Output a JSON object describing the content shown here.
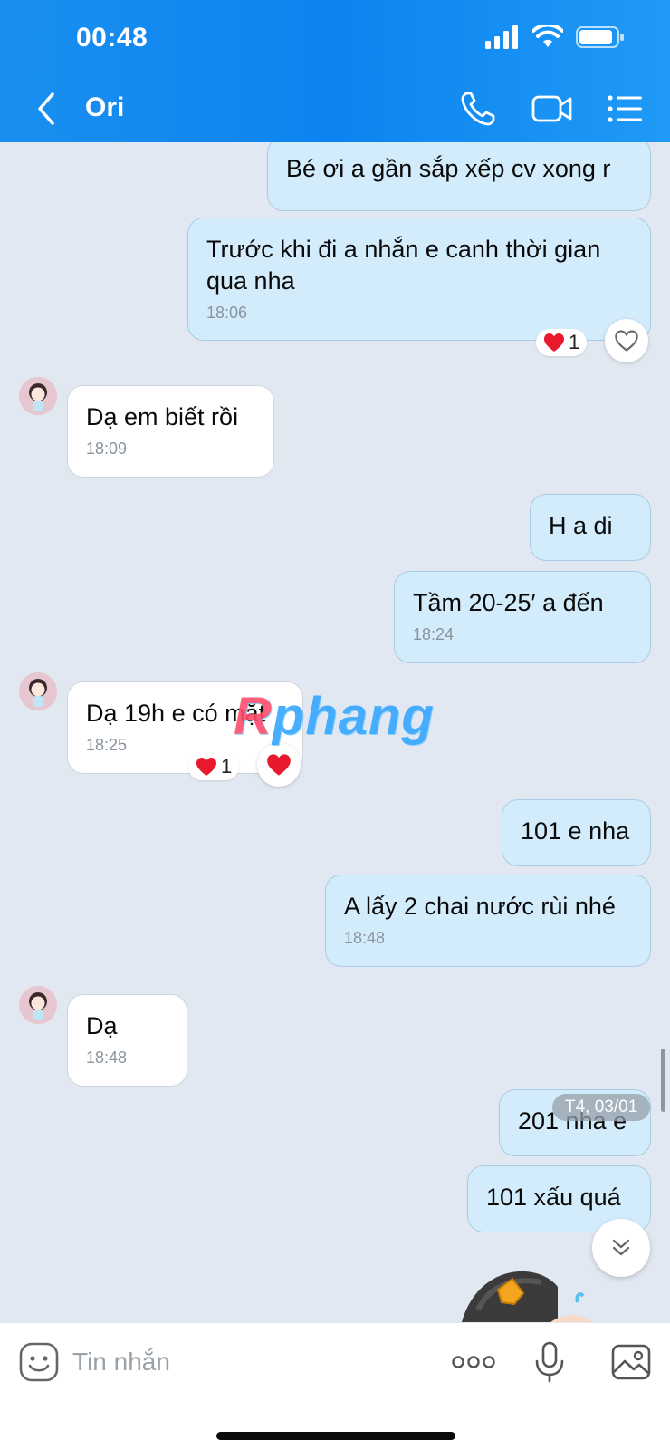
{
  "status_bar": {
    "time": "00:48",
    "icons": [
      "signal-icon",
      "wifi-icon",
      "battery-icon"
    ]
  },
  "header": {
    "title": "Ori",
    "icons": [
      "back-icon",
      "phone-icon",
      "video-call-icon",
      "menu-list-icon"
    ],
    "background": "#0c84f0"
  },
  "messages": [
    {
      "dir": "out",
      "text": "Bé ơi a gần sắp xếp cv xong r"
    },
    {
      "dir": "out",
      "text": "Trước khi đi a nhắn e canh thời gian qua nha",
      "time": "18:06",
      "reaction_count": "1"
    },
    {
      "dir": "in",
      "text": "Dạ em biết rồi",
      "time": "18:09"
    },
    {
      "dir": "out",
      "text": "H a di"
    },
    {
      "dir": "out",
      "text": "Tầm 20-25′ a đến",
      "time": "18:24"
    },
    {
      "dir": "in",
      "text": "Dạ 19h e có mặt",
      "time": "18:25",
      "reaction_count": "1"
    },
    {
      "dir": "out",
      "text": "101 e nha"
    },
    {
      "dir": "out",
      "text": "A lấy 2 chai nước rùi nhé",
      "time": "18:48"
    },
    {
      "dir": "in",
      "text": "Dạ",
      "time": "18:48"
    },
    {
      "dir": "out",
      "text": "201 nha e"
    },
    {
      "dir": "out",
      "text": "101 xấu quá"
    }
  ],
  "date_separator": "T4, 03/01",
  "watermark": {
    "text_r": "R",
    "text_rest": "phang"
  },
  "composer": {
    "placeholder": "Tin nhắn",
    "icons": [
      "emoji-icon",
      "more-icon",
      "microphone-icon",
      "image-icon"
    ]
  },
  "colors": {
    "outgoing_bubble": "#d3ecfb",
    "incoming_bubble": "#ffffff",
    "chat_background": "#e2e8f1",
    "heart": "#e8192c"
  }
}
